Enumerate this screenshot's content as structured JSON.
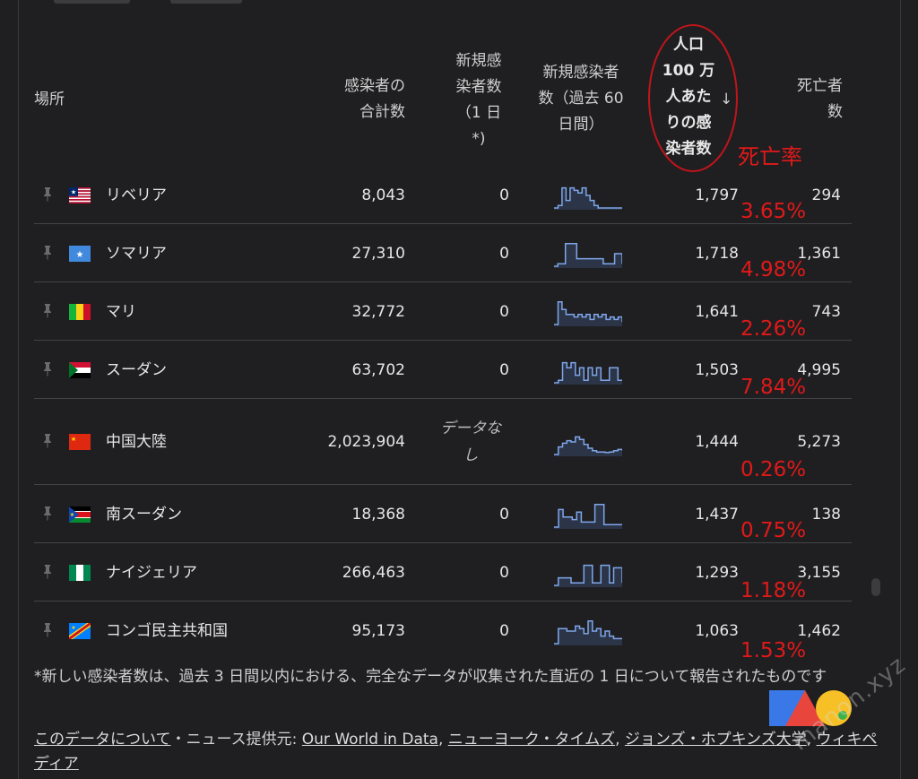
{
  "header": {
    "place": "場所",
    "total_cases": [
      "感染者の",
      "合計数"
    ],
    "new_cases": [
      "新規感",
      "染者数",
      "（1 日",
      "*)"
    ],
    "new_cases_60d": [
      "新規感染者",
      "数（過去 60",
      "日間）"
    ],
    "per_million": [
      "人口",
      "100 万",
      "人あた",
      "りの感",
      "染者数"
    ],
    "sort_arrow": "↓",
    "deaths": [
      "死亡者",
      "数"
    ]
  },
  "annotation": {
    "death_rate_label": "死亡率",
    "color": "#e01919"
  },
  "rows": [
    {
      "name": "リベリア",
      "total": "8,043",
      "new": "0",
      "per_million": "1,797",
      "deaths": "294",
      "rate": "3.65%",
      "flag": "liberia-flag"
    },
    {
      "name": "ソマリア",
      "total": "27,310",
      "new": "0",
      "per_million": "1,718",
      "deaths": "1,361",
      "rate": "4.98%",
      "flag": "somalia-flag"
    },
    {
      "name": "マリ",
      "total": "32,772",
      "new": "0",
      "per_million": "1,641",
      "deaths": "743",
      "rate": "2.26%",
      "flag": "mali-flag"
    },
    {
      "name": "スーダン",
      "total": "63,702",
      "new": "0",
      "per_million": "1,503",
      "deaths": "4,995",
      "rate": "7.84%",
      "flag": "sudan-flag"
    },
    {
      "name": "中国大陸",
      "total": "2,023,904",
      "new": "データなし",
      "per_million": "1,444",
      "deaths": "5,273",
      "rate": "0.26%",
      "flag": "china-flag"
    },
    {
      "name": "南スーダン",
      "total": "18,368",
      "new": "0",
      "per_million": "1,437",
      "deaths": "138",
      "rate": "0.75%",
      "flag": "south-sudan-flag"
    },
    {
      "name": "ナイジェリア",
      "total": "266,463",
      "new": "0",
      "per_million": "1,293",
      "deaths": "3,155",
      "rate": "1.18%",
      "flag": "nigeria-flag"
    },
    {
      "name": "コンゴ民主共和国",
      "total": "95,173",
      "new": "0",
      "per_million": "1,063",
      "deaths": "1,462",
      "rate": "1.53%",
      "flag": "drc-flag"
    }
  ],
  "footnote": "*新しい感染者数は、過去 3 日間以内における、完全なデータが収集された直近の 1 日について報告されたものです",
  "sources": {
    "about": "このデータについて",
    "separator": "・ニュース提供元: ",
    "links": [
      "Our World in Data",
      "ニューヨーク・タイムズ",
      "ジョンズ・ホプキンズ大学",
      "ウィキペディア"
    ]
  },
  "watermark": "manon.xyz",
  "colors": {
    "background": "#1f1f21",
    "sparkline": "#7fa6ea",
    "sparkline_fill": "#2b3547",
    "divider": "#444446"
  }
}
